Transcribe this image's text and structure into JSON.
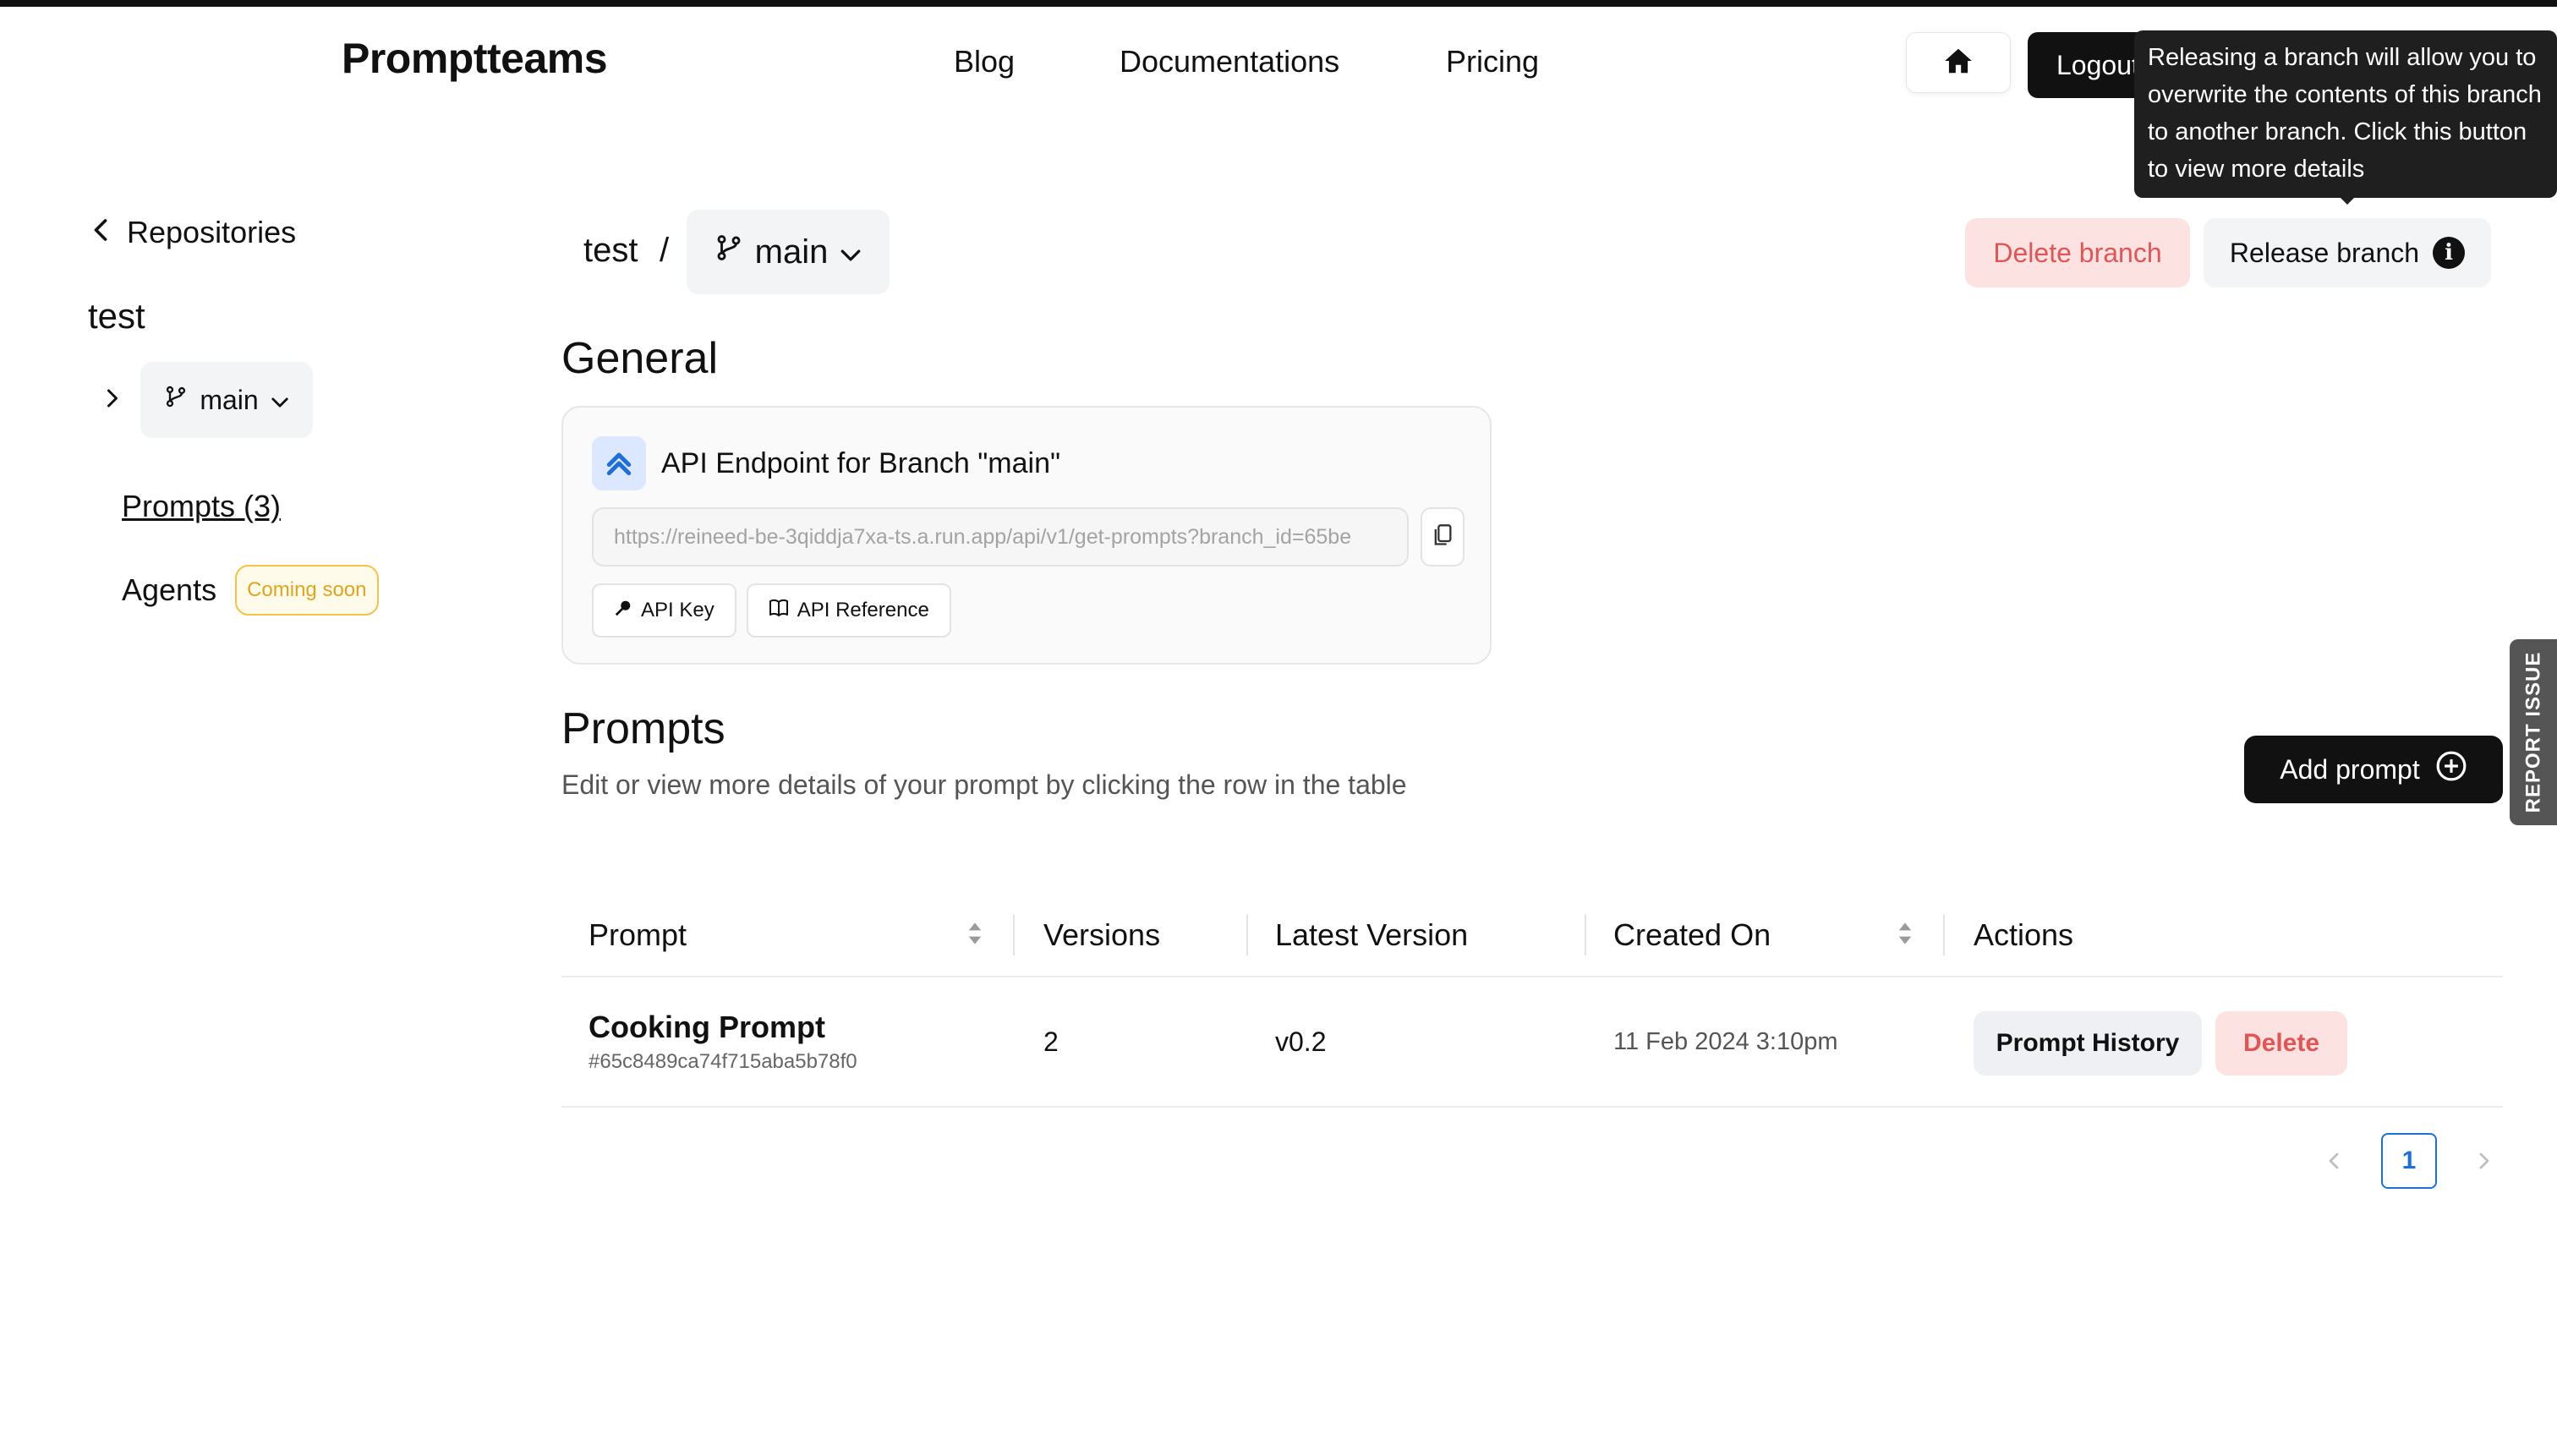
{
  "header": {
    "logo": "Promptteams",
    "nav": [
      "Blog",
      "Documentations",
      "Pricing"
    ],
    "logout_label": "Logout"
  },
  "tooltip": {
    "text": "Releasing a branch will allow you to overwrite the contents of this branch to another branch. Click this button to view more details"
  },
  "sidebar": {
    "back_label": "Repositories",
    "repo_name": "test",
    "branch": "main",
    "items": [
      {
        "label": "Prompts (3)"
      },
      {
        "label": "Agents",
        "badge": "Coming soon"
      }
    ]
  },
  "breadcrumb": {
    "repo": "test",
    "separator": "/",
    "branch": "main"
  },
  "actions": {
    "delete_branch": "Delete branch",
    "release_branch": "Release branch",
    "info_glyph": "i"
  },
  "general": {
    "title": "General",
    "api_card": {
      "title": "API Endpoint for Branch \"main\"",
      "url": "https://reineed-be-3qiddja7xa-ts.a.run.app/api/v1/get-prompts?branch_id=65be",
      "buttons": [
        "API Key",
        "API Reference"
      ]
    }
  },
  "prompts": {
    "title": "Prompts",
    "subtitle": "Edit or view more details of your prompt by clicking the row in the table",
    "add_label": "Add prompt",
    "columns": [
      "Prompt",
      "Versions",
      "Latest Version",
      "Created On",
      "Actions"
    ],
    "rows": [
      {
        "name": "Cooking Prompt",
        "id": "#65c8489ca74f715aba5b78f0",
        "versions": "2",
        "latest_version": "v0.2",
        "created_on": "11 Feb 2024 3:10pm",
        "history_label": "Prompt History",
        "delete_label": "Delete"
      }
    ],
    "pagination": {
      "current_page": "1"
    }
  },
  "report_issue": "REPORT ISSUE",
  "colors": {
    "danger": "#e25555",
    "danger_bg": "#fde2e2",
    "accent": "#1e6fd9",
    "badge": "#f5c24b"
  }
}
